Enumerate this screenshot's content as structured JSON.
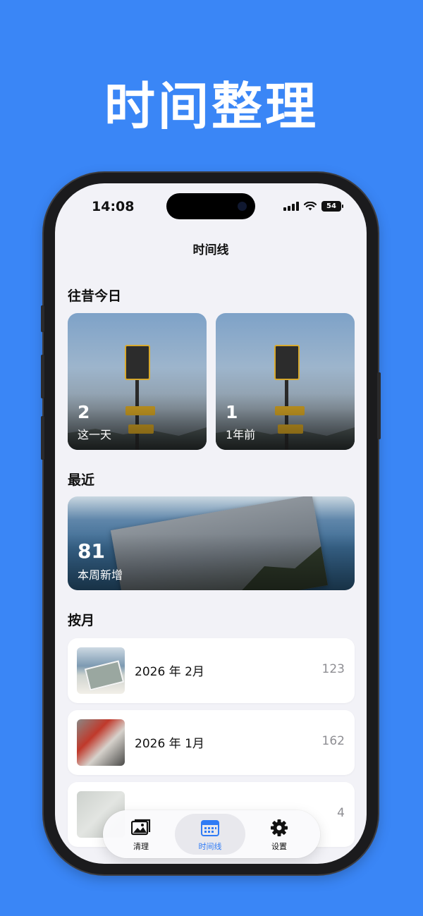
{
  "banner": {
    "title": "时间整理"
  },
  "status_bar": {
    "time": "14:08",
    "battery": "54"
  },
  "nav": {
    "title": "时间线"
  },
  "sections": {
    "on_this_day": "往昔今日",
    "recent": "最近",
    "by_month": "按月"
  },
  "on_this_day_cards": [
    {
      "count": "2",
      "label": "这一天"
    },
    {
      "count": "1",
      "label": "1年前"
    }
  ],
  "recent_card": {
    "count": "81",
    "label": "本周新增"
  },
  "months": [
    {
      "label": "2026 年 2月",
      "count": "123"
    },
    {
      "label": "2026 年 1月",
      "count": "162"
    },
    {
      "label": "",
      "count": "4"
    }
  ],
  "tabbar": {
    "items": [
      {
        "label": "清理",
        "icon": "photo-icon"
      },
      {
        "label": "时间线",
        "icon": "calendar-icon"
      },
      {
        "label": "设置",
        "icon": "gear-icon"
      }
    ],
    "active": "时间线",
    "accent": "#2f7bf5"
  },
  "colors": {
    "background": "#3a86f6",
    "screen": "#f2f2f7"
  }
}
